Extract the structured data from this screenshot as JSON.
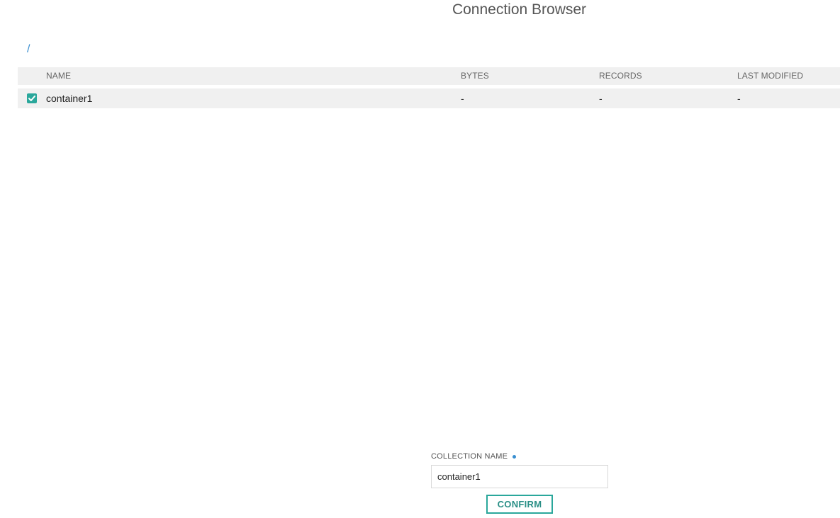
{
  "header": {
    "title": "Connection Browser"
  },
  "breadcrumb": {
    "path": "/"
  },
  "table": {
    "columns": {
      "name": "NAME",
      "bytes": "BYTES",
      "records": "RECORDS",
      "last_modified": "LAST MODIFIED"
    },
    "rows": [
      {
        "checked": true,
        "name": "container1",
        "bytes": "-",
        "records": "-",
        "last_modified": "-"
      }
    ]
  },
  "form": {
    "collection_label": "COLLECTION NAME",
    "collection_value": "container1",
    "confirm_label": "CONFIRM"
  },
  "colors": {
    "accent": "#2aa79b",
    "link": "#3a8fd0",
    "row_background": "#f0f0f0"
  },
  "icons": {
    "checkbox": "checkmark-icon",
    "required": "required-dot-icon"
  }
}
